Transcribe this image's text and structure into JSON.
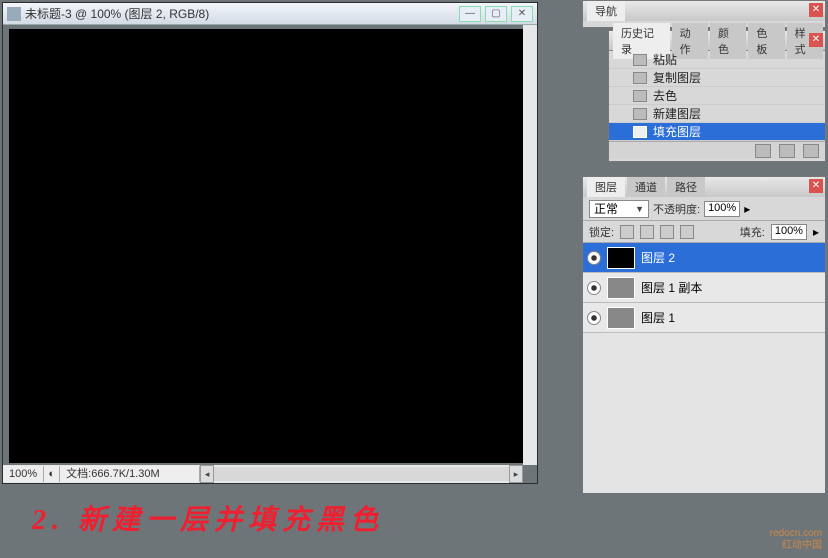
{
  "document": {
    "title": "未标题-3 @ 100% (图层 2, RGB/8)",
    "zoom": "100%",
    "doc_info": "文档:666.7K/1.30M"
  },
  "win_btns": {
    "min": "—",
    "max": "▢",
    "close": "✕"
  },
  "nav": {
    "tab": "导航"
  },
  "history": {
    "tabs": [
      "历史记录",
      "动作",
      "颜色",
      "色板",
      "样式"
    ],
    "items": [
      "粘贴",
      "复制图层",
      "去色",
      "新建图层",
      "填充图层"
    ]
  },
  "layers_panel": {
    "tabs": [
      "图层",
      "通道",
      "路径"
    ],
    "blend_mode": "正常",
    "opacity_label": "不透明度:",
    "opacity_value": "100%",
    "lock_label": "锁定:",
    "fill_label": "填充:",
    "fill_value": "100%",
    "layers": [
      {
        "name": "图层 2",
        "black": true,
        "sel": true
      },
      {
        "name": "图层 1 副本",
        "black": false,
        "sel": false
      },
      {
        "name": "图层 1",
        "black": false,
        "sel": false
      }
    ]
  },
  "annotation": {
    "num": "2.",
    "text": "新建一层并填充黑色"
  },
  "watermark": {
    "line1": "redocn.com",
    "line2": "红动中国"
  }
}
